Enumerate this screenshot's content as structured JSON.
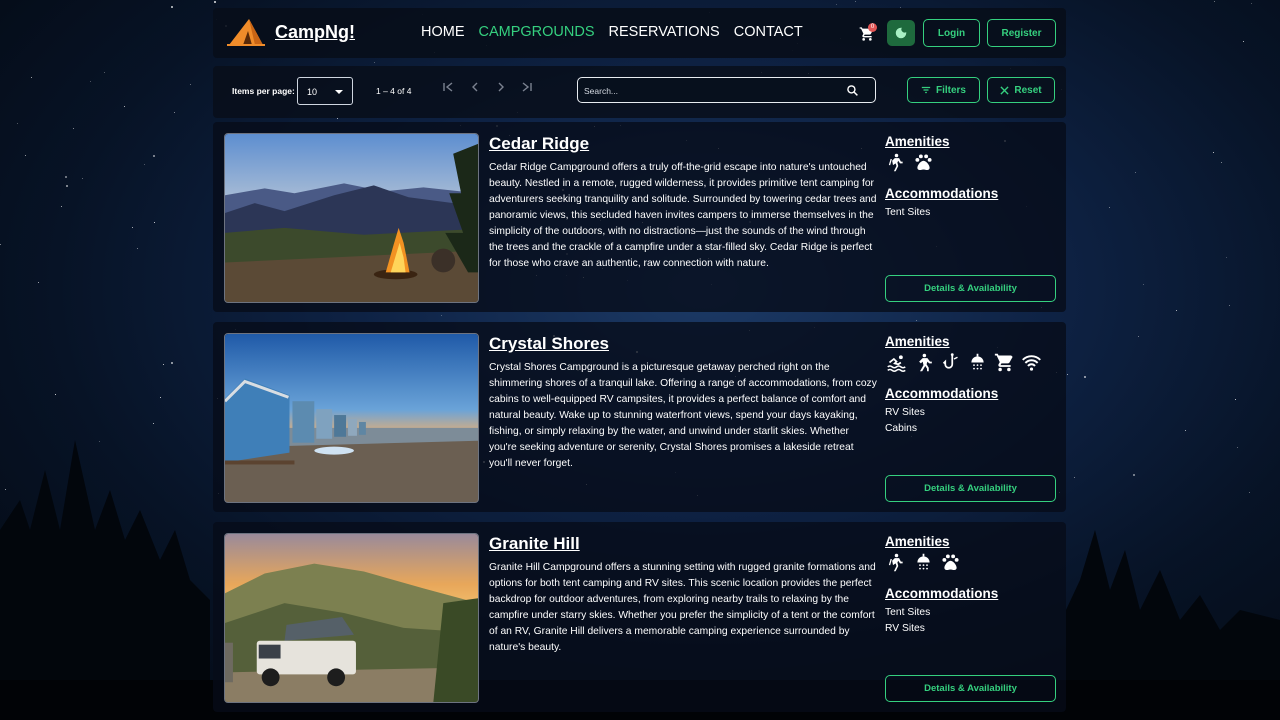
{
  "nav": {
    "brand": "CampNg!",
    "links": [
      "HOME",
      "CAMPGROUNDS",
      "RESERVATIONS",
      "CONTACT"
    ],
    "active_link": "CAMPGROUNDS",
    "cart_count": "0",
    "login_label": "Login",
    "register_label": "Register"
  },
  "toolbar": {
    "items_per_page_label": "Items per page:",
    "items_per_page_value": "10",
    "range_label": "1 – 4 of 4",
    "search_placeholder": "Search...",
    "filters_label": "Filters",
    "reset_label": "Reset"
  },
  "colors": {
    "accent": "#35d07f",
    "card_bg": "#060c18",
    "badge": "#e05555"
  },
  "campgrounds": [
    {
      "name": "Cedar Ridge",
      "description": "Cedar Ridge Campground offers a truly off-the-grid escape into nature's untouched beauty. Nestled in a remote, rugged wilderness, it provides primitive tent camping for adventurers seeking tranquility and solitude. Surrounded by towering cedar trees and panoramic views, this secluded haven invites campers to immerse themselves in the simplicity of the outdoors, with no distractions—just the sounds of the wind through the trees and the crackle of a campfire under a star-filled sky. Cedar Ridge is perfect for those who crave an authentic, raw connection with nature.",
      "amenities_label": "Amenities",
      "amenities": [
        "hiking-icon",
        "pets-icon"
      ],
      "accommodations_label": "Accommodations",
      "accommodations": [
        "Tent Sites"
      ],
      "details_label": "Details & Availability"
    },
    {
      "name": "Crystal Shores",
      "description": "Crystal Shores Campground is a picturesque getaway perched right on the shimmering shores of a tranquil lake. Offering a range of accommodations, from cozy cabins to well-equipped RV campsites, it provides a perfect balance of comfort and natural beauty. Wake up to stunning waterfront views, spend your days kayaking, fishing, or simply relaxing by the water, and unwind under starlit skies. Whether you're seeking adventure or serenity, Crystal Shores promises a lakeside retreat you'll never forget.",
      "amenities_label": "Amenities",
      "amenities": [
        "swimming-icon",
        "hiking-icon",
        "fishing-icon",
        "shower-icon",
        "store-icon",
        "wifi-icon"
      ],
      "accommodations_label": "Accommodations",
      "accommodations": [
        "RV Sites",
        "Cabins"
      ],
      "details_label": "Details & Availability"
    },
    {
      "name": "Granite Hill",
      "description": "Granite Hill Campground offers a stunning setting with rugged granite formations and options for both tent camping and RV sites. This scenic location provides the perfect backdrop for outdoor adventures, from exploring nearby trails to relaxing by the campfire under starry skies. Whether you prefer the simplicity of a tent or the comfort of an RV, Granite Hill delivers a memorable camping experience surrounded by nature's beauty.",
      "amenities_label": "Amenities",
      "amenities": [
        "hiking-icon",
        "shower-icon",
        "pets-icon"
      ],
      "accommodations_label": "Accommodations",
      "accommodations": [
        "Tent Sites",
        "RV Sites"
      ],
      "details_label": "Details & Availability"
    }
  ]
}
